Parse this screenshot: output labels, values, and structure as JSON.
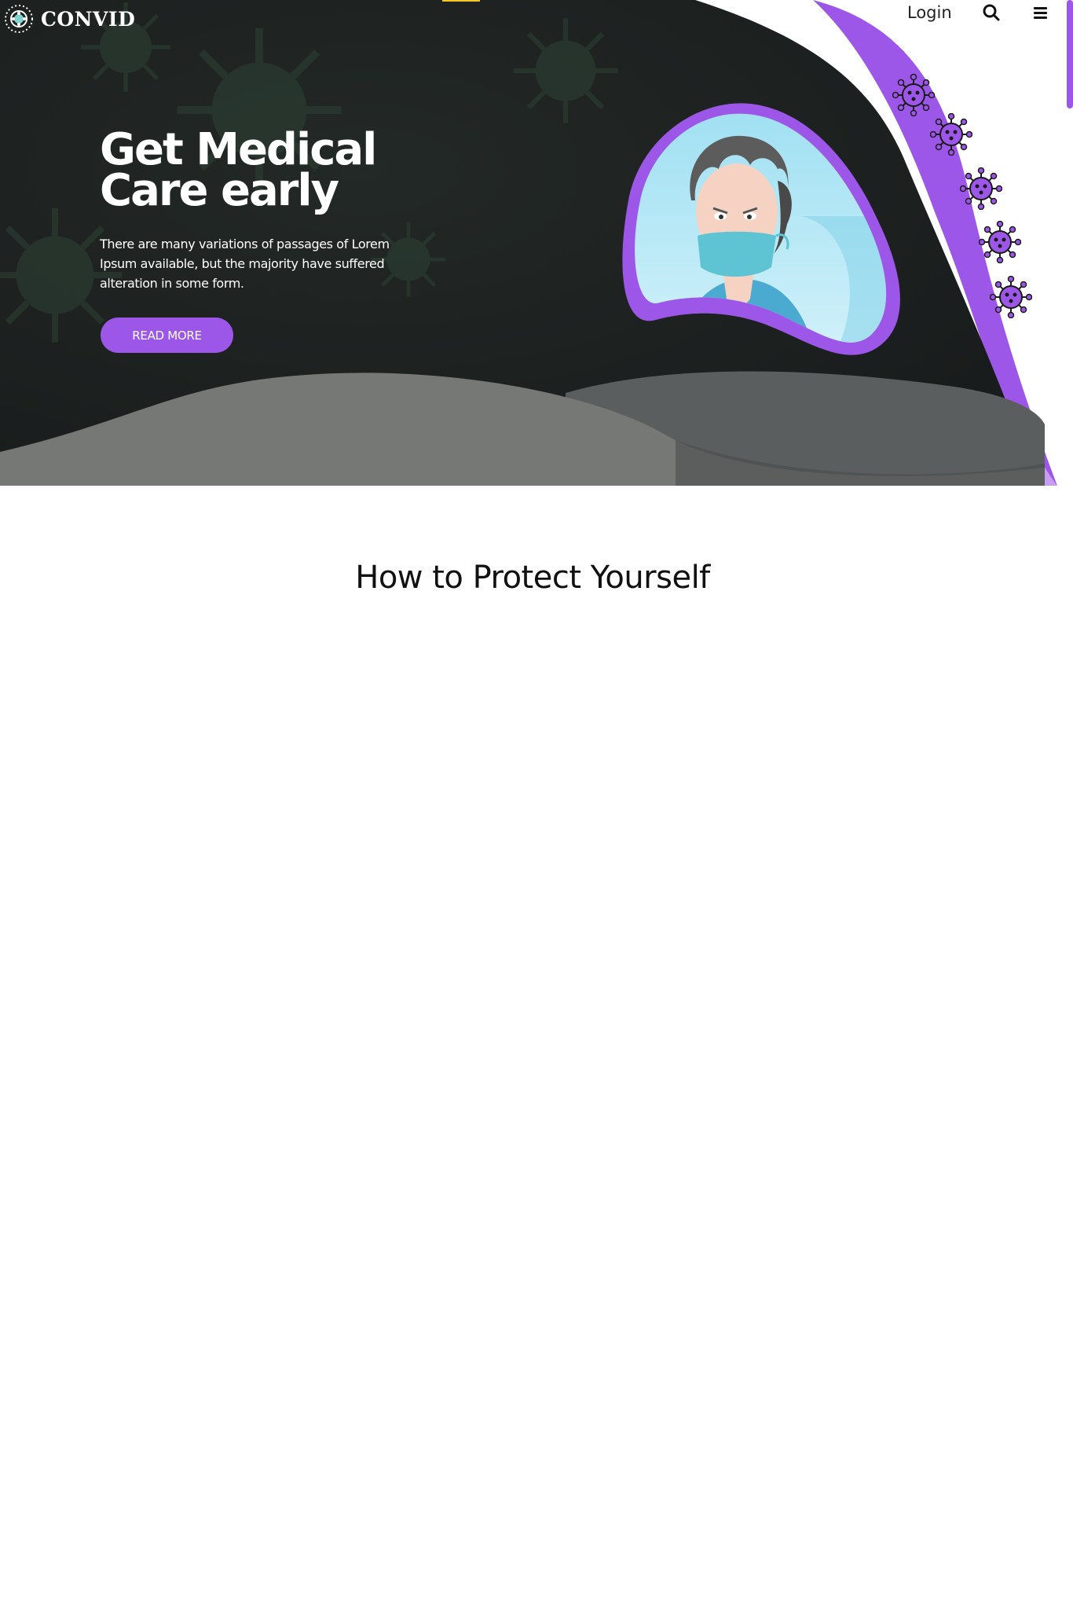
{
  "brand": {
    "name": "CONVID"
  },
  "nav": {
    "login_label": "Login"
  },
  "hero": {
    "title": "Get Medical Care early",
    "description": "There are many variations of passages of Lorem Ipsum available, but the majority have suffered alteration in some form.",
    "cta_label": "READ MORE"
  },
  "protect_section": {
    "title": "How to Protect Yourself"
  },
  "colors": {
    "accent_purple": "#9d57e8",
    "hero_dark": "#1c1f1f",
    "top_accent": "#f3c623",
    "wave_gray": "#767875"
  },
  "icons": [
    "virus-logo-icon",
    "search-icon",
    "hamburger-menu-icon",
    "virus-icon"
  ]
}
